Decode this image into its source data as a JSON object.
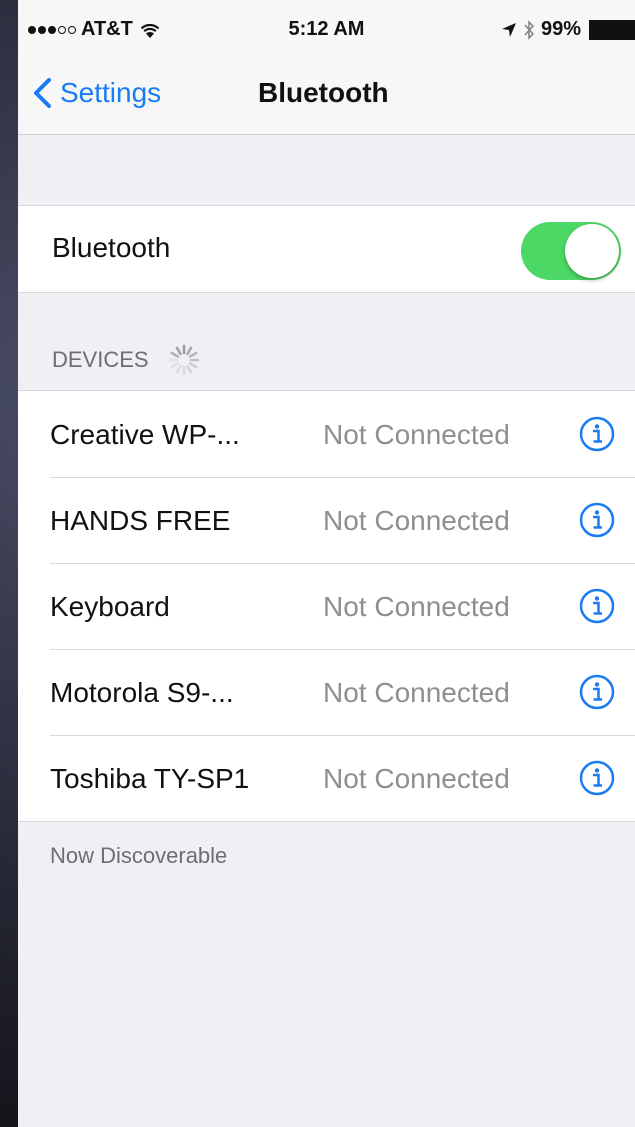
{
  "status_bar": {
    "carrier": "AT&T",
    "signal_bars": 5,
    "signal_filled": 3,
    "time": "5:12 AM",
    "battery": "99%",
    "icons": [
      "wifi-icon",
      "location-arrow-icon",
      "bluetooth-icon",
      "battery-icon"
    ]
  },
  "nav": {
    "back_label": "Settings",
    "title": "Bluetooth"
  },
  "bluetooth_toggle": {
    "label": "Bluetooth",
    "on": true
  },
  "devices_section": {
    "header": "DEVICES",
    "devices": [
      {
        "name": "Creative WP-...",
        "status": "Not Connected"
      },
      {
        "name": "HANDS FREE",
        "status": "Not Connected"
      },
      {
        "name": "Keyboard",
        "status": "Not Connected"
      },
      {
        "name": "Motorola S9-...",
        "status": "Not Connected"
      },
      {
        "name": "Toshiba TY-SP1",
        "status": "Not Connected"
      }
    ]
  },
  "footer_text": "Now Discoverable",
  "colors": {
    "accent": "#1a7cf5",
    "toggle_on": "#4cd864",
    "background": "#efeff4",
    "secondary_text": "#8e8e93"
  }
}
